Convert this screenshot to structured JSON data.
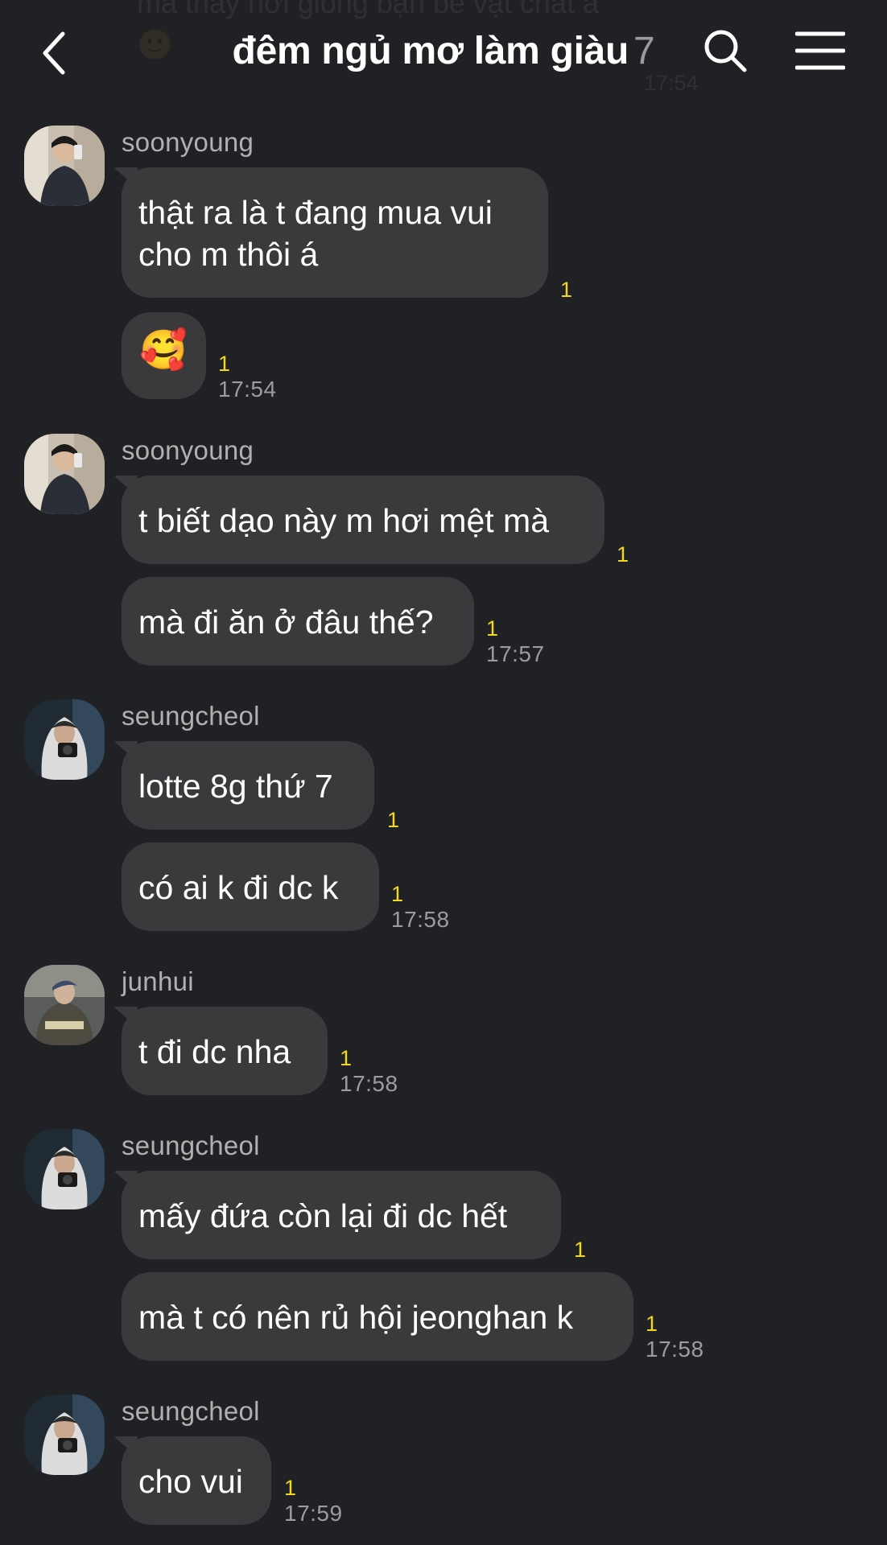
{
  "header": {
    "title": "đêm ngủ mơ làm giàu",
    "member_count": "7",
    "ghost_text": "mà thấy hơi giống bạn bè vật chất à 🙂",
    "ghost_time": "17:54"
  },
  "messages": [
    {
      "sender": "soonyoung",
      "bubbles": [
        {
          "text": "thật ra là t đang mua vui cho m thôi á",
          "read": "1",
          "time": ""
        },
        {
          "text": "🥰",
          "read": "1",
          "time": "17:54"
        }
      ]
    },
    {
      "sender": "soonyoung",
      "bubbles": [
        {
          "text": "t biết dạo này m hơi mệt mà",
          "read": "1",
          "time": ""
        },
        {
          "text": "mà đi ăn ở đâu thế?",
          "read": "1",
          "time": "17:57"
        }
      ]
    },
    {
      "sender": "seungcheol",
      "bubbles": [
        {
          "text": "lotte 8g thứ 7",
          "read": "1",
          "time": ""
        },
        {
          "text": "có ai k đi dc k",
          "read": "1",
          "time": "17:58"
        }
      ]
    },
    {
      "sender": "junhui",
      "bubbles": [
        {
          "text": "t đi dc nha",
          "read": "1",
          "time": "17:58"
        }
      ]
    },
    {
      "sender": "seungcheol",
      "bubbles": [
        {
          "text": "mấy đứa còn lại đi dc hết",
          "read": "1",
          "time": ""
        },
        {
          "text": "mà t có nên rủ hội jeonghan k",
          "read": "1",
          "time": "17:58"
        }
      ]
    },
    {
      "sender": "seungcheol",
      "bubbles": [
        {
          "text": "cho vui",
          "read": "1",
          "time": "17:59"
        }
      ]
    }
  ],
  "colors": {
    "background": "#202124",
    "bubble": "#3a3a3c",
    "read_count": "#f2d81e",
    "timestamp": "#9c9c9c"
  },
  "icons": [
    "back-chevron-icon",
    "search-icon",
    "menu-icon"
  ]
}
